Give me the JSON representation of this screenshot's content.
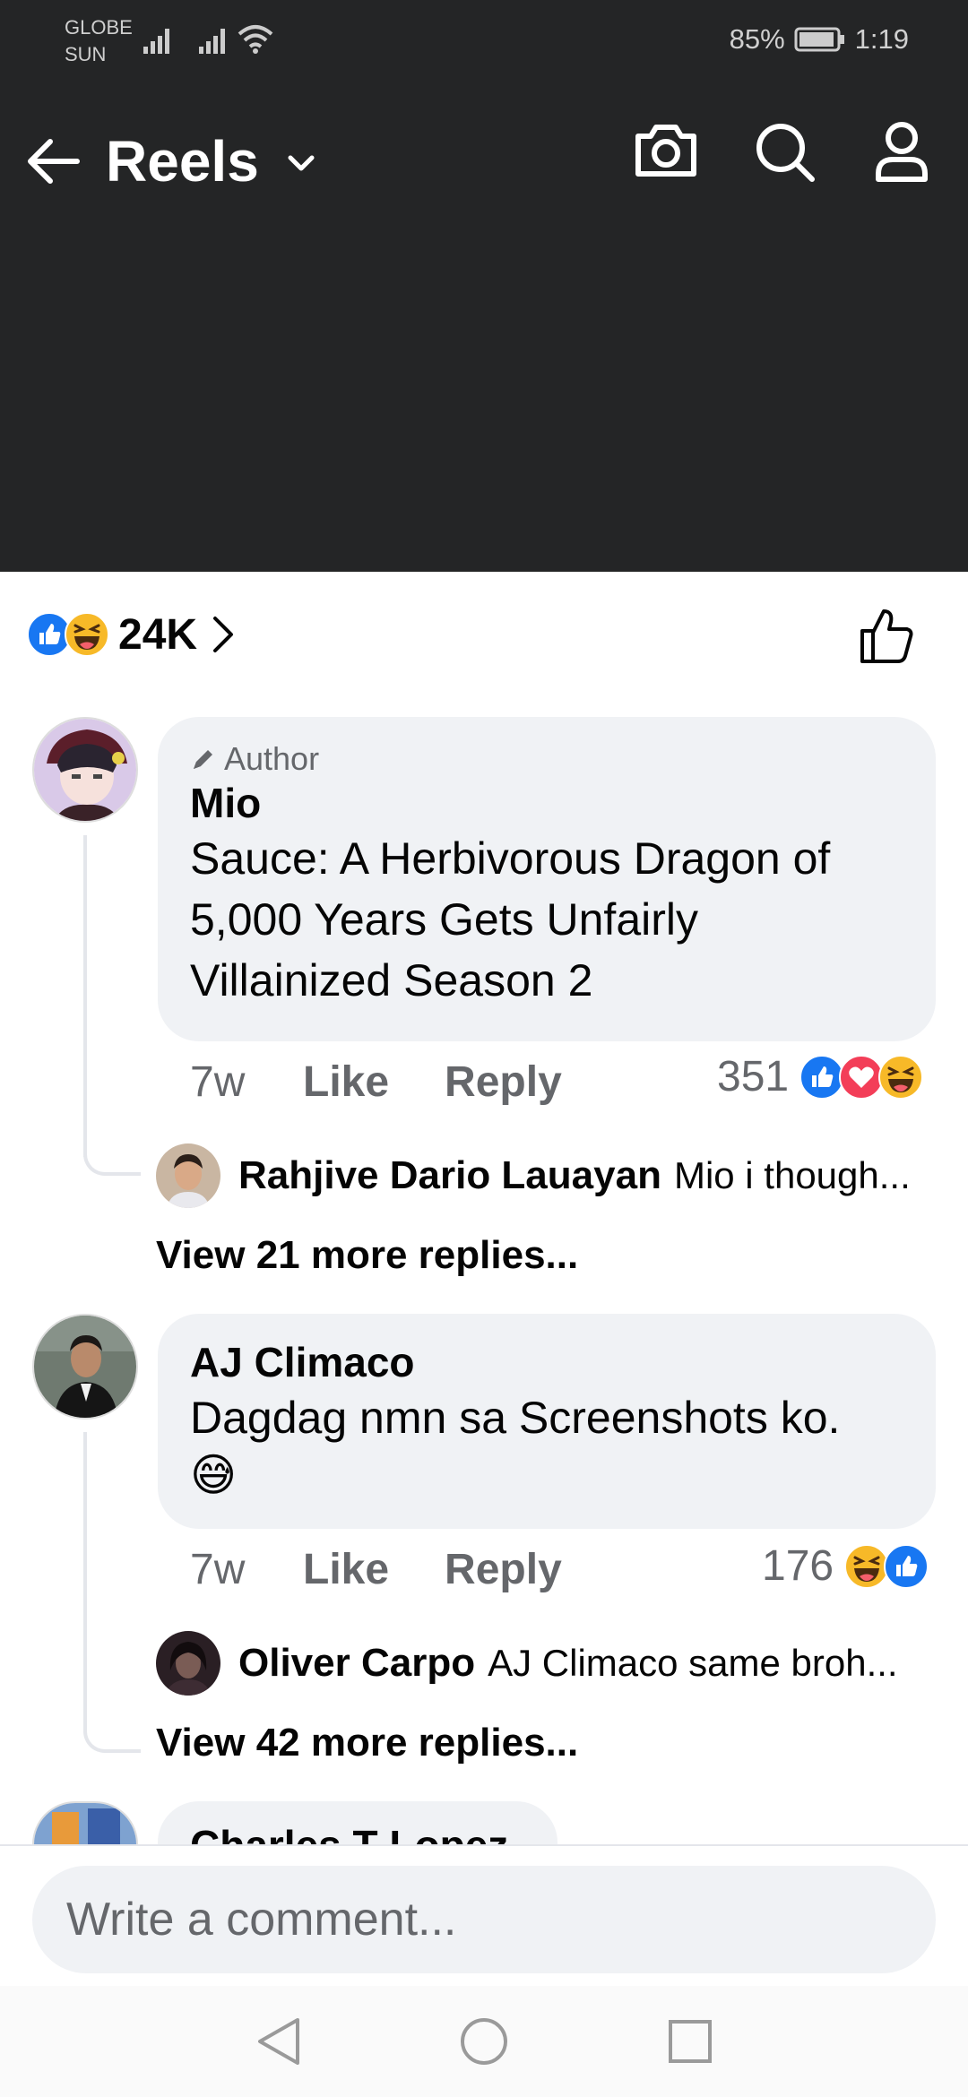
{
  "status_bar": {
    "carrier_1": "GLOBE",
    "carrier_2": "SUN",
    "battery": "85%",
    "time": "1:19"
  },
  "header": {
    "title": "Reels",
    "icons": [
      "back-arrow-icon",
      "chevron-down-icon",
      "camera-icon",
      "search-icon",
      "profile-icon"
    ]
  },
  "reactions_summary": {
    "count": "24K",
    "icons": [
      "like-icon",
      "haha-icon"
    ]
  },
  "comments": [
    {
      "author_tag": "Author",
      "name": "Mio",
      "text": "Sauce: A Herbivorous Dragon of 5,000 Years Gets Unfairly Villainized Season 2",
      "time": "7w",
      "like_label": "Like",
      "reply_label": "Reply",
      "reaction_count": "351",
      "reactions": [
        "like-icon",
        "love-icon",
        "haha-icon"
      ],
      "reply_preview": {
        "name": "Rahjive Dario Lauayan",
        "text": "Mio i though..."
      },
      "view_more": "View 21 more replies..."
    },
    {
      "name": "AJ Climaco",
      "text": "Dagdag nmn sa Screenshots ko.",
      "emoji": "😅",
      "time": "7w",
      "like_label": "Like",
      "reply_label": "Reply",
      "reaction_count": "176",
      "reactions": [
        "haha-icon",
        "like-icon"
      ],
      "reply_preview": {
        "name": "Oliver Carpo",
        "text": "AJ Climaco same broh..."
      },
      "view_more": "View 42 more replies..."
    },
    {
      "name": "Charles T Lopez"
    }
  ],
  "composer": {
    "placeholder": "Write a comment..."
  },
  "colors": {
    "dark_background": "#242526",
    "bubble": "#f0f2f5",
    "secondary_text": "#65676b",
    "like_blue": "#1877f2",
    "love_red": "#f33e58",
    "haha_yellow": "#f7b928"
  }
}
